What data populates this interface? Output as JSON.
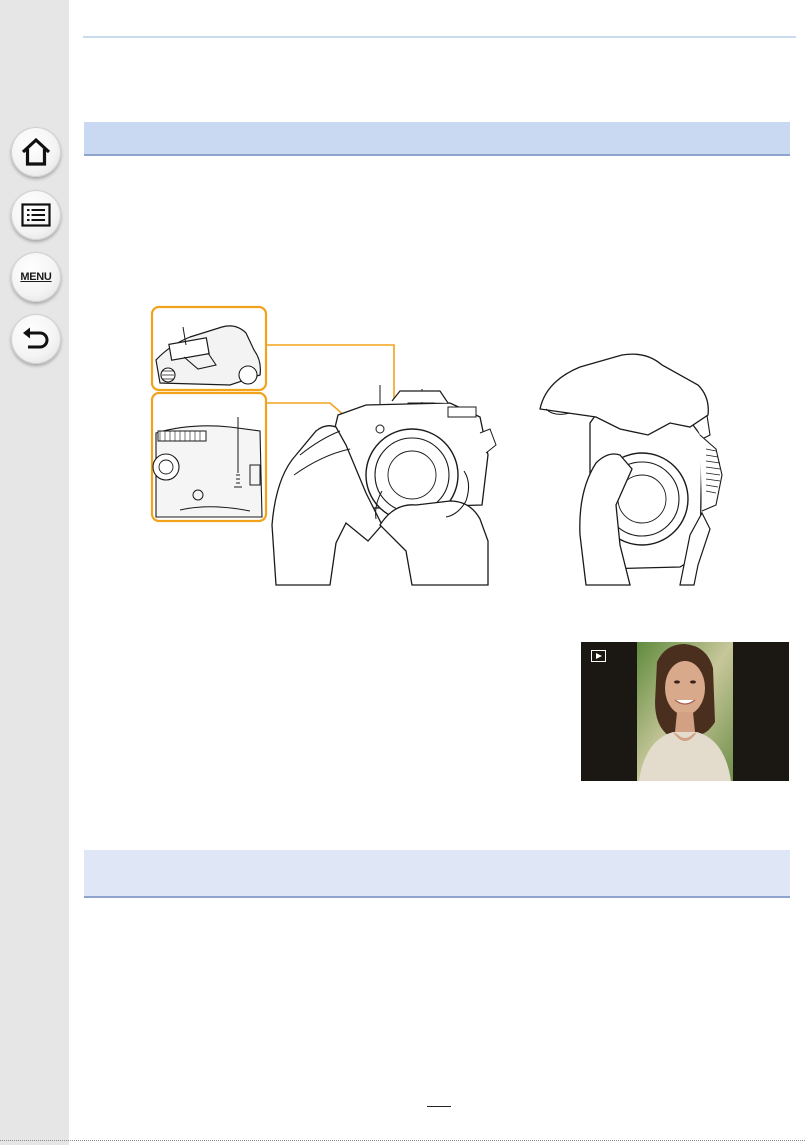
{
  "sidebar": {
    "buttons": [
      {
        "name": "home",
        "icon": "home-icon"
      },
      {
        "name": "contents",
        "icon": "list-icon"
      },
      {
        "name": "menu",
        "icon": "menu-label",
        "label": "MENU"
      },
      {
        "name": "back",
        "icon": "back-arrow-icon"
      }
    ]
  },
  "colors": {
    "sidebar_bg": "#e6e6e6",
    "header_bg": "#c9d9f2",
    "header_rule": "#8ea4cf",
    "callout_orange": "#f2a31c"
  },
  "illustrations": [
    {
      "name": "camera-held-landscape",
      "callouts": 4
    },
    {
      "name": "camera-held-portrait"
    }
  ],
  "photo": {
    "icon": "playback-icon"
  }
}
